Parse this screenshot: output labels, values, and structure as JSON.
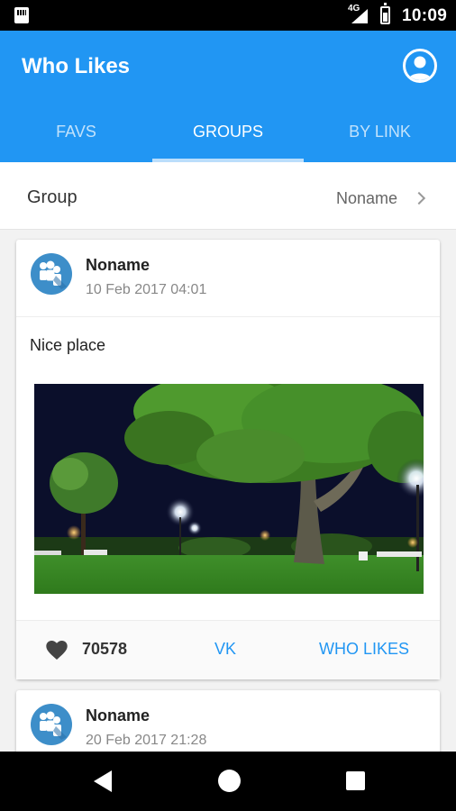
{
  "status_bar": {
    "time": "10:09",
    "network": "4G"
  },
  "app": {
    "title": "Who Likes",
    "accent": "#2196f3"
  },
  "tabs": [
    {
      "label": "FAVS",
      "active": false
    },
    {
      "label": "GROUPS",
      "active": true
    },
    {
      "label": "BY LINK",
      "active": false
    }
  ],
  "group_selector": {
    "label": "Group",
    "value": "Noname"
  },
  "posts": [
    {
      "author": "Noname",
      "date": "10 Feb 2017 04:01",
      "text": "Nice place",
      "image": "night-park-photo",
      "likes": "70578",
      "vk_label": "VK",
      "who_likes_label": "WHO LIKES"
    },
    {
      "author": "Noname",
      "date": "20 Feb 2017 21:28"
    }
  ]
}
